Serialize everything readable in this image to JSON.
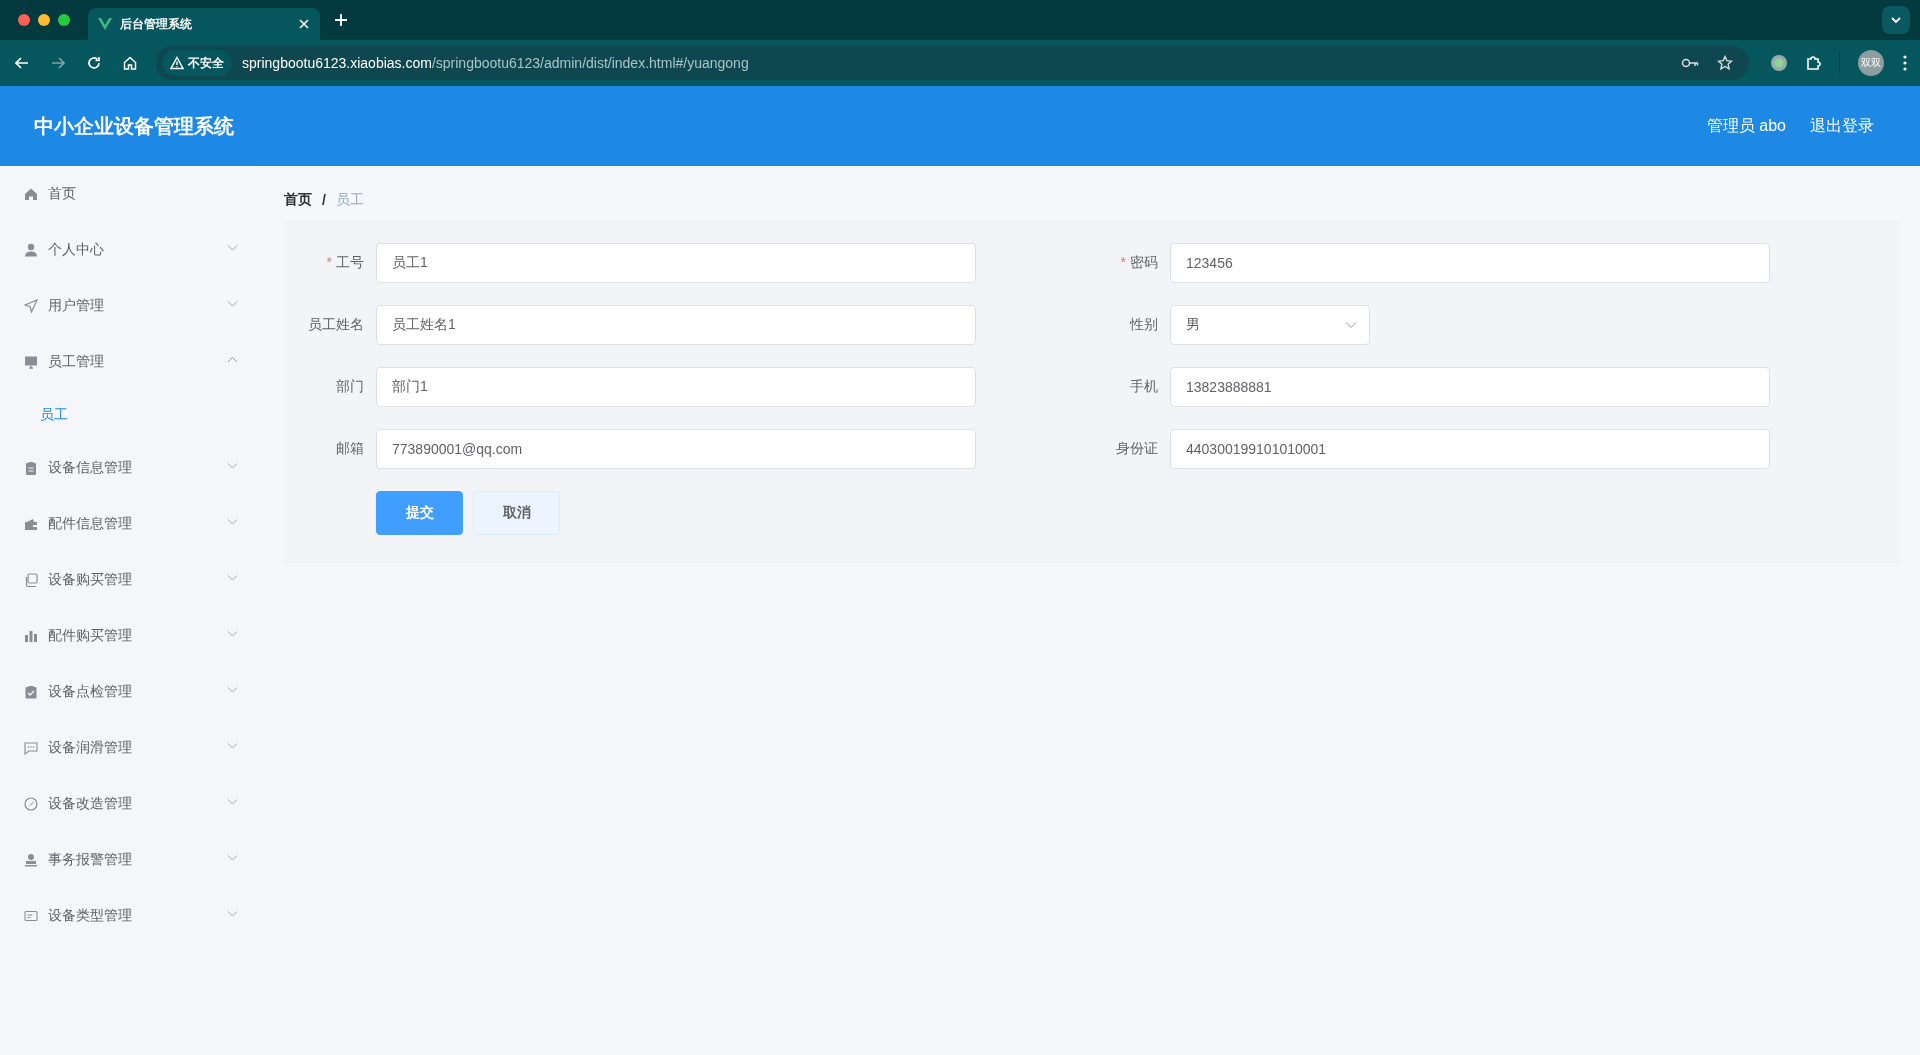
{
  "browser": {
    "tab_title": "后台管理系统",
    "security_label": "不安全",
    "url_host": "springbootu6123.xiaobias.com",
    "url_path": "/springbootu6123/admin/dist/index.html#/yuangong",
    "profile": "双双"
  },
  "header": {
    "title": "中小企业设备管理系统",
    "user": "管理员 abo",
    "logout": "退出登录"
  },
  "sidebar": {
    "items": [
      {
        "label": "首页",
        "kind": "link"
      },
      {
        "label": "个人中心",
        "kind": "submenu",
        "expanded": false
      },
      {
        "label": "用户管理",
        "kind": "submenu",
        "expanded": false
      },
      {
        "label": "员工管理",
        "kind": "submenu",
        "expanded": true,
        "children": [
          {
            "label": "员工",
            "selected": true
          }
        ]
      },
      {
        "label": "设备信息管理",
        "kind": "submenu",
        "expanded": false
      },
      {
        "label": "配件信息管理",
        "kind": "submenu",
        "expanded": false
      },
      {
        "label": "设备购买管理",
        "kind": "submenu",
        "expanded": false
      },
      {
        "label": "配件购买管理",
        "kind": "submenu",
        "expanded": false
      },
      {
        "label": "设备点检管理",
        "kind": "submenu",
        "expanded": false
      },
      {
        "label": "设备润滑管理",
        "kind": "submenu",
        "expanded": false
      },
      {
        "label": "设备改造管理",
        "kind": "submenu",
        "expanded": false
      },
      {
        "label": "事务报警管理",
        "kind": "submenu",
        "expanded": false
      },
      {
        "label": "设备类型管理",
        "kind": "submenu",
        "expanded": false
      }
    ]
  },
  "breadcrumb_separator": "/",
  "breadcrumb": [
    {
      "label": "首页",
      "current": false
    },
    {
      "label": "员工",
      "current": true
    }
  ],
  "form": {
    "required_mark": "*",
    "fields": [
      {
        "label": "工号",
        "required": true,
        "kind": "input",
        "value": "员工1"
      },
      {
        "label": "密码",
        "required": true,
        "kind": "input",
        "value": "123456"
      },
      {
        "label": "员工姓名",
        "required": false,
        "kind": "input",
        "value": "员工姓名1"
      },
      {
        "label": "性别",
        "required": false,
        "kind": "select",
        "value": "男"
      },
      {
        "label": "部门",
        "required": false,
        "kind": "input",
        "value": "部门1"
      },
      {
        "label": "手机",
        "required": false,
        "kind": "input",
        "value": "13823888881"
      },
      {
        "label": "邮箱",
        "required": false,
        "kind": "input",
        "value": "773890001@qq.com"
      },
      {
        "label": "身份证",
        "required": false,
        "kind": "input",
        "value": "440300199101010001"
      }
    ],
    "buttons": [
      {
        "label": "提交",
        "kind": "primary"
      },
      {
        "label": "取消",
        "kind": "default"
      }
    ]
  }
}
